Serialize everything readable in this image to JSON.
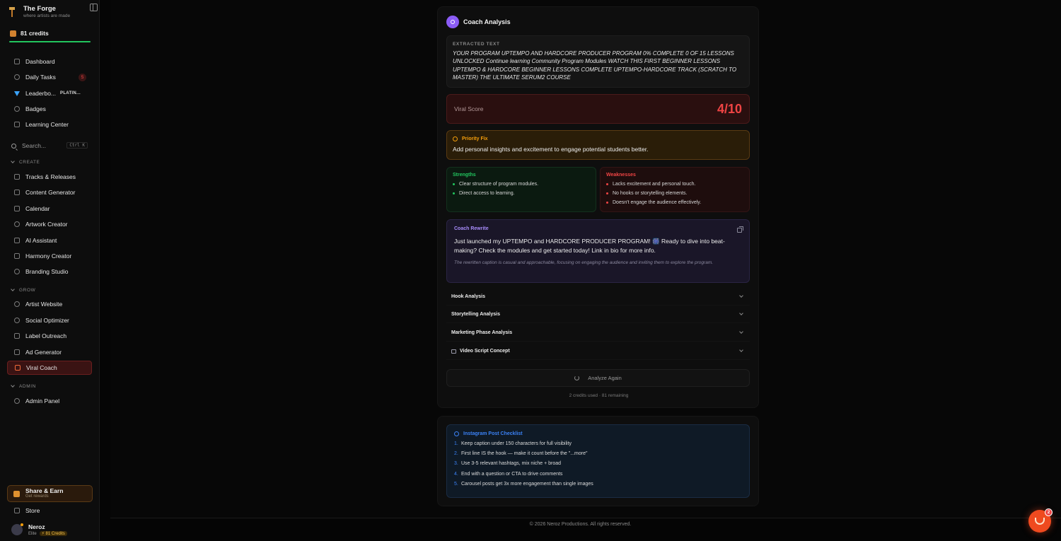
{
  "brand": {
    "title": "The Forge",
    "subtitle": "where artists are made"
  },
  "credits": {
    "label": "81 credits",
    "progress": 1.0
  },
  "nav_top": [
    {
      "label": "Dashboard"
    },
    {
      "label": "Daily Tasks",
      "badge": "5"
    },
    {
      "label": "Leaderbo...",
      "tag": "PLATIN..."
    },
    {
      "label": "Badges"
    },
    {
      "label": "Learning Center"
    }
  ],
  "search": {
    "placeholder": "Search...",
    "shortcut": "Ctrl K"
  },
  "sections": {
    "create": "CREATE",
    "grow": "GROW",
    "admin": "ADMIN"
  },
  "nav_create": [
    {
      "label": "Tracks & Releases"
    },
    {
      "label": "Content Generator"
    },
    {
      "label": "Calendar"
    },
    {
      "label": "Artwork Creator"
    },
    {
      "label": "AI Assistant"
    },
    {
      "label": "Harmony Creator"
    },
    {
      "label": "Branding Studio"
    }
  ],
  "nav_grow": [
    {
      "label": "Artist Website"
    },
    {
      "label": "Social Optimizer"
    },
    {
      "label": "Label Outreach"
    },
    {
      "label": "Ad Generator"
    },
    {
      "label": "Viral Coach"
    }
  ],
  "nav_admin": [
    {
      "label": "Admin Panel"
    }
  ],
  "share": {
    "title": "Share & Earn",
    "subtitle": "Get rewards"
  },
  "store": {
    "label": "Store"
  },
  "user": {
    "name": "Neroz",
    "tier": "Elite",
    "credits": "⚡ 81 Credits"
  },
  "coach": {
    "title": "Coach Analysis",
    "extracted_label": "EXTRACTED TEXT",
    "extracted_text": "YOUR PROGRAM UPTEMPO AND HARDCORE PRODUCER PROGRAM 0% COMPLETE 0 OF 15 LESSONS UNLOCKED Continue learning Community Program Modules WATCH THIS FIRST BEGINNER LESSONS UPTEMPO & HARDCORE BEGINNER LESSONS COMPLETE UPTEMPO-HARDCORE TRACK (SCRATCH TO MASTER) THE ULTIMATE SERUM2 COURSE",
    "viral_label": "Viral Score",
    "viral_score": "4/10",
    "priority_label": "Priority Fix",
    "priority_text": "Add personal insights and excitement to engage potential students better.",
    "strengths_label": "Strengths",
    "strengths": [
      "Clear structure of program modules.",
      "Direct access to learning."
    ],
    "weaknesses_label": "Weaknesses",
    "weaknesses": [
      "Lacks excitement and personal touch.",
      "No hooks or storytelling elements.",
      "Doesn't engage the audience effectively."
    ],
    "rewrite_label": "Coach Rewrite",
    "rewrite_text": "Just launched my UPTEMPO and HARDCORE PRODUCER PROGRAM! 🎆 Ready to dive into beat-making? Check the modules and get started today! Link in bio for more info.",
    "rewrite_note": "The rewritten caption is casual and approachable, focusing on engaging the audience and inviting them to explore the program.",
    "accordions": [
      "Hook Analysis",
      "Storytelling Analysis",
      "Marketing Phase Analysis",
      "Video Script Concept"
    ],
    "analyze_again": "Analyze Again",
    "usage": "2 credits used · 81 remaining"
  },
  "checklist": {
    "title": "Instagram Post Checklist",
    "items": [
      "Keep caption under 150 characters for full visibility",
      "First line IS the hook — make it count before the \"...more\"",
      "Use 3-5 relevant hashtags, mix niche + broad",
      "End with a question or CTA to drive comments",
      "Carousel posts get 3x more engagement than single images"
    ]
  },
  "footer": "© 2026 Neroz Productions. All rights reserved.",
  "notification_count": "2",
  "colors": {
    "accent_red": "#ef4444",
    "accent_violet": "#8b5cf6",
    "accent_green": "#22c55e",
    "accent_amber": "#f59e0b",
    "accent_blue": "#3b82f6"
  }
}
